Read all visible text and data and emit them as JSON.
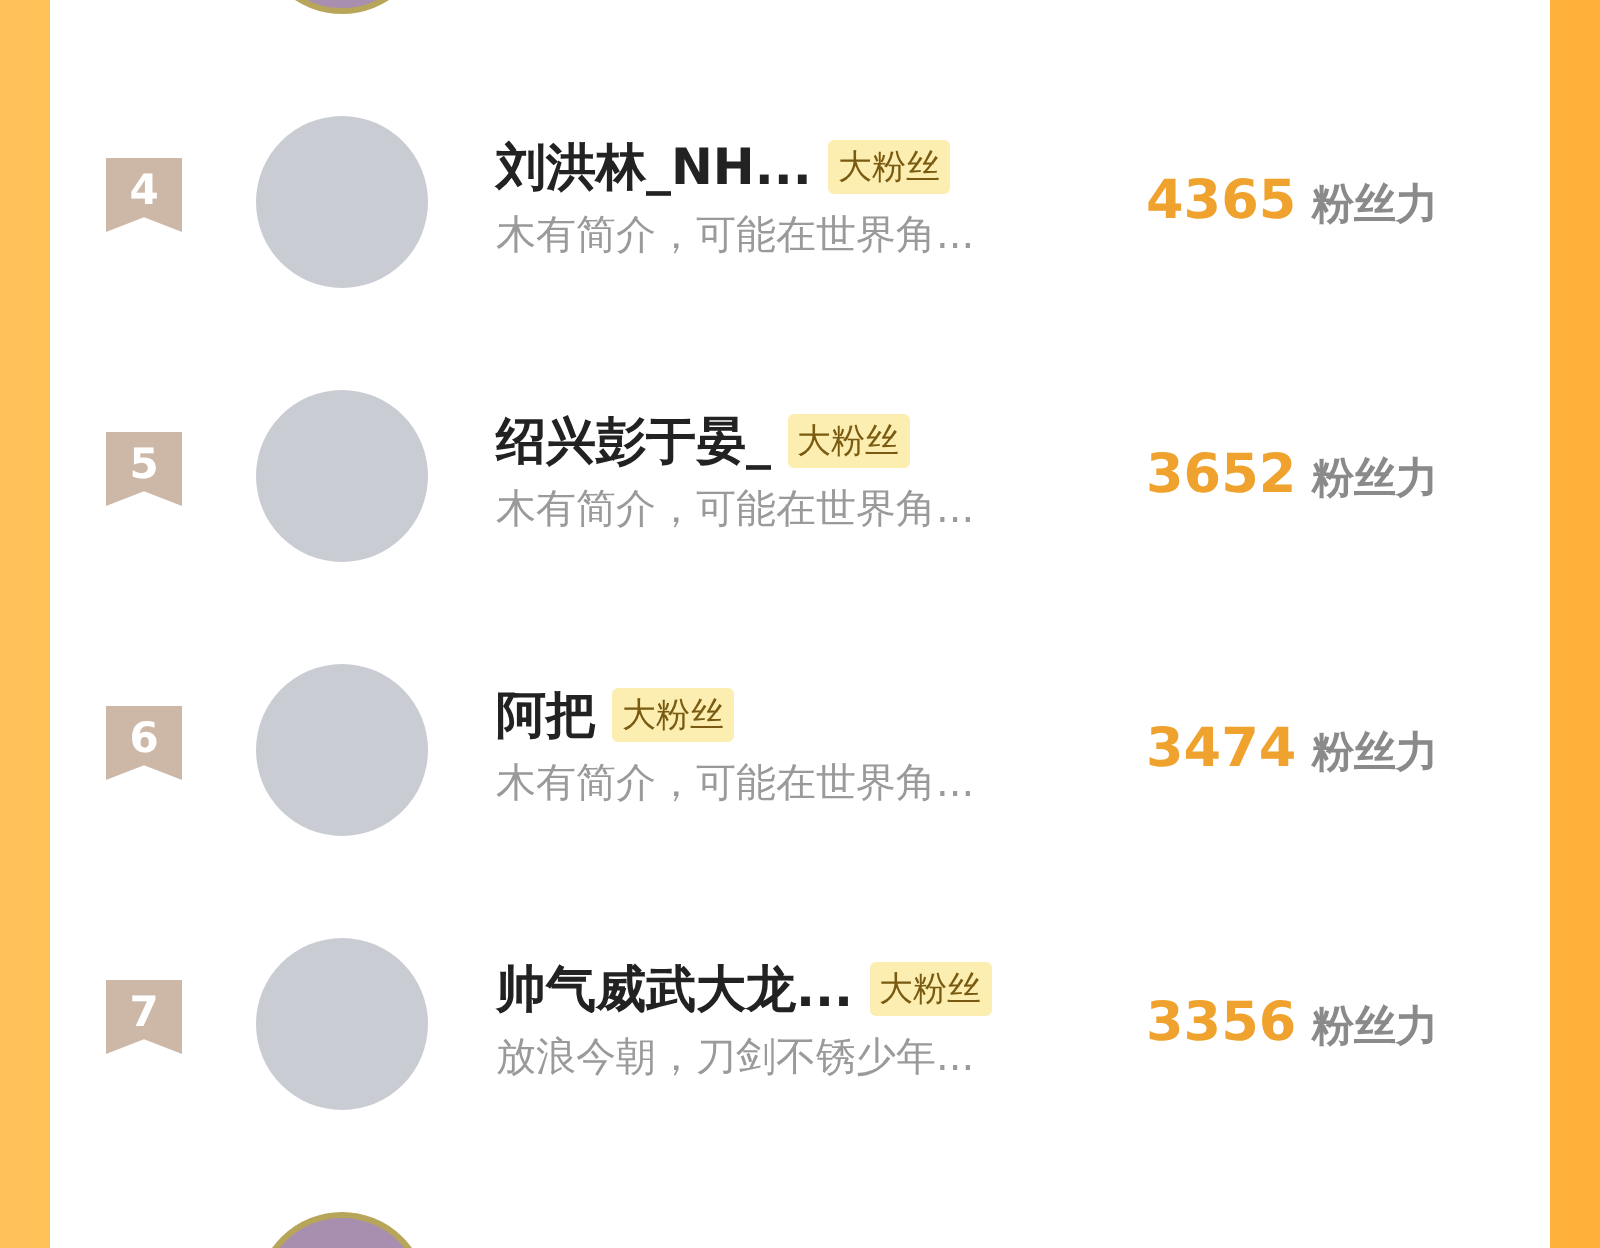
{
  "rows": [
    {
      "kind": "avatar_only"
    },
    {
      "kind": "entry",
      "rank": "4",
      "name": "刘洪林_NH...",
      "badge": "大粉丝",
      "bio": "木有简介，可能在世界角...",
      "score": "4365",
      "unit": "粉丝力"
    },
    {
      "kind": "entry",
      "rank": "5",
      "name": "绍兴彭于晏_",
      "badge": "大粉丝",
      "bio": "木有简介，可能在世界角...",
      "score": "3652",
      "unit": "粉丝力"
    },
    {
      "kind": "entry",
      "rank": "6",
      "name": "阿把",
      "badge": "大粉丝",
      "bio": "木有简介，可能在世界角...",
      "score": "3474",
      "unit": "粉丝力"
    },
    {
      "kind": "entry",
      "rank": "7",
      "name": "帅气威武大龙...",
      "badge": "大粉丝",
      "bio": "放浪今朝，刀剑不锈少年...",
      "score": "3356",
      "unit": "粉丝力"
    },
    {
      "kind": "avatar_only"
    }
  ]
}
